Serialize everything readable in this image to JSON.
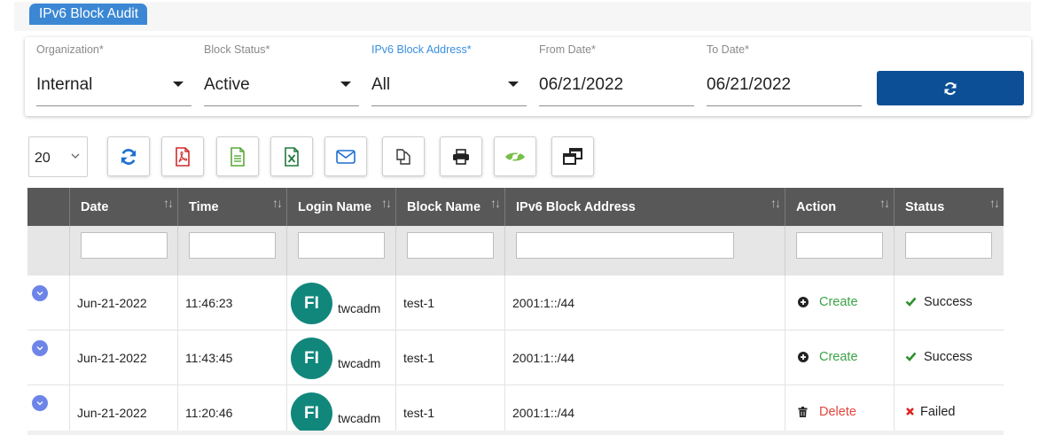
{
  "page": {
    "tab_title": "IPv6 Block Audit"
  },
  "filters": {
    "organization": {
      "label": "Organization*",
      "value": "Internal"
    },
    "block_status": {
      "label": "Block Status*",
      "value": "Active"
    },
    "ipv6_block_address": {
      "label": "IPv6 Block Address*",
      "value": "All"
    },
    "from_date": {
      "label": "From Date*",
      "value": "06/21/2022"
    },
    "to_date": {
      "label": "To Date*",
      "value": "06/21/2022"
    },
    "refresh_icon": "refresh-icon"
  },
  "toolbar": {
    "page_size": "20",
    "buttons": [
      "refresh-icon",
      "pdf-icon",
      "csv-icon",
      "excel-icon",
      "email-icon",
      "copy-icon",
      "print-icon",
      "column-visibility-icon",
      "restore-icon"
    ]
  },
  "table": {
    "columns": [
      "Date",
      "Time",
      "Login Name",
      "Block Name",
      "IPv6 Block Address",
      "Action",
      "Status"
    ],
    "rows": [
      {
        "date": "Jun-21-2022",
        "time": "11:46:23",
        "avatar": "FI",
        "login": "twcadm",
        "block": "test-1",
        "address": "2001:1::/44",
        "action": "Create",
        "status": "Success"
      },
      {
        "date": "Jun-21-2022",
        "time": "11:43:45",
        "avatar": "FI",
        "login": "twcadm",
        "block": "test-1",
        "address": "2001:1::/44",
        "action": "Create",
        "status": "Success"
      },
      {
        "date": "Jun-21-2022",
        "time": "11:20:46",
        "avatar": "FI",
        "login": "twcadm",
        "block": "test-1",
        "address": "2001:1::/44",
        "action": "Delete",
        "status": "Failed"
      }
    ]
  },
  "colors": {
    "primary": "#0c4f96",
    "tab": "#3b87d4",
    "header": "#585858",
    "avatar": "#11877c",
    "create": "#3aa346",
    "delete": "#e2453c",
    "success": "#2f8f2f",
    "failed": "#e02020"
  }
}
